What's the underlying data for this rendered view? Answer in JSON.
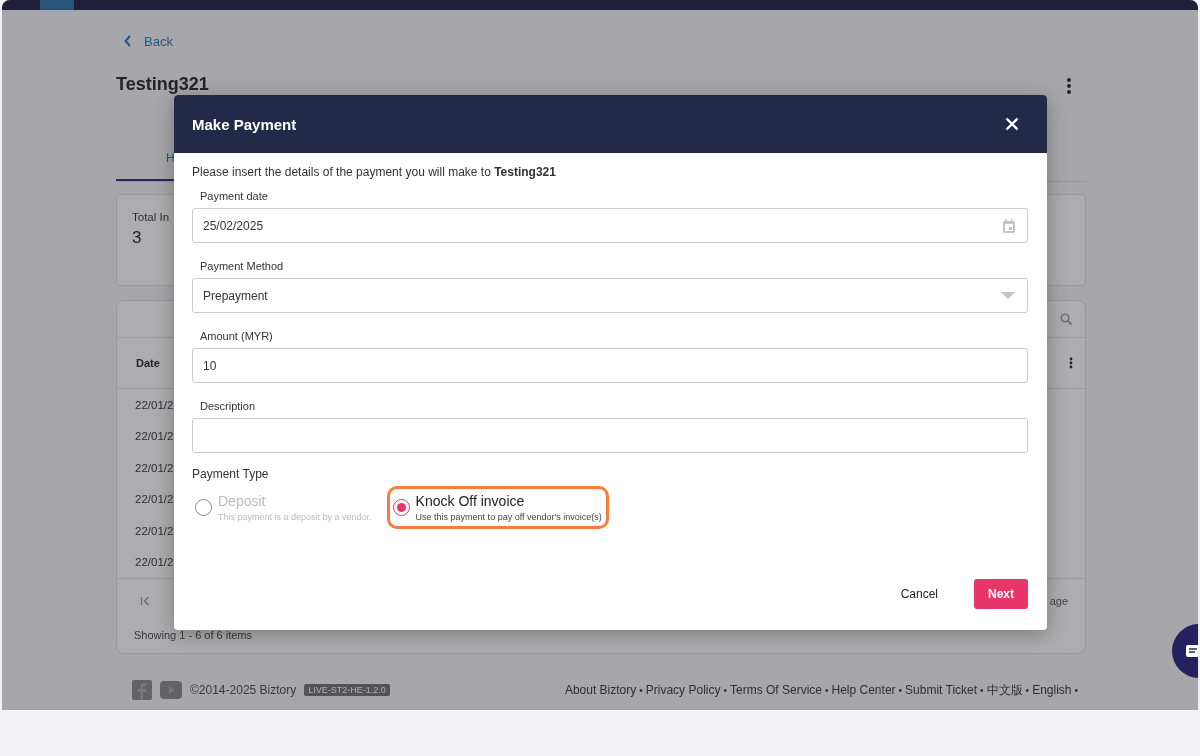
{
  "page": {
    "back_link": "Back",
    "title": "Testing321",
    "tab": "H",
    "summary": {
      "label": "Total In",
      "value": "3"
    },
    "table": {
      "columns": [
        "Date"
      ],
      "rows": [
        [
          "22/01/2"
        ],
        [
          "22/01/2"
        ],
        [
          "22/01/2"
        ],
        [
          "22/01/2"
        ],
        [
          "22/01/2"
        ],
        [
          "22/01/2"
        ]
      ],
      "pager_text": "age",
      "showing": "Showing 1 - 6 of 6 items"
    },
    "footer": {
      "copyright": "©2014-2025 Biztory",
      "version": "LIVE-ST2-HE-1.2.0",
      "separator": "•",
      "links": [
        "About Biztory",
        "Privacy Policy",
        "Terms Of Service",
        "Help Center",
        "Submit Ticket",
        "中文版",
        "English"
      ]
    }
  },
  "dialog": {
    "title": "Make Payment",
    "intro": "Please insert the details of the payment you will make to **Testing321**",
    "fields": [
      {
        "label": "Payment date",
        "value": "25/02/2025",
        "kind": "date"
      },
      {
        "label": "Payment Method",
        "value": "Prepayment",
        "kind": "select"
      },
      {
        "label": "Amount (MYR)",
        "value": "10",
        "kind": "text"
      },
      {
        "label": "Description",
        "kind": "text"
      }
    ],
    "payment_type": {
      "label": "Payment Type",
      "options": [
        {
          "title": "Deposit",
          "hint": "This payment is a deposit by a vendor.",
          "selected": false,
          "highlighted": false
        },
        {
          "title": "Knock Off invoice",
          "hint": "Use this payment to pay off vendor's invoice(s)",
          "selected": true,
          "highlighted": true
        }
      ]
    },
    "buttons": [
      {
        "label": "Cancel",
        "kind": "plain"
      },
      {
        "label": "Next",
        "kind": "primary"
      }
    ]
  }
}
